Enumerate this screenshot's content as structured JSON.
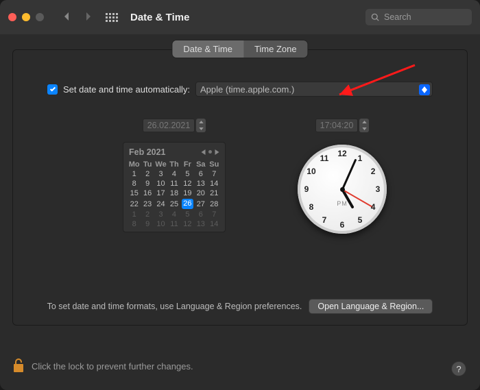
{
  "window": {
    "title": "Date & Time"
  },
  "search": {
    "placeholder": "Search"
  },
  "tabs": {
    "date_time": "Date & Time",
    "time_zone": "Time Zone"
  },
  "auto": {
    "label": "Set date and time automatically:",
    "server": "Apple (time.apple.com.)",
    "checked": true
  },
  "date_field": "26.02.2021",
  "time_field": "17:04:20",
  "calendar": {
    "title": "Feb 2021",
    "dow": [
      "Mo",
      "Tu",
      "We",
      "Th",
      "Fr",
      "Sa",
      "Su"
    ],
    "weeks": [
      [
        {
          "d": "1"
        },
        {
          "d": "2"
        },
        {
          "d": "3"
        },
        {
          "d": "4"
        },
        {
          "d": "5"
        },
        {
          "d": "6"
        },
        {
          "d": "7"
        }
      ],
      [
        {
          "d": "8"
        },
        {
          "d": "9"
        },
        {
          "d": "10"
        },
        {
          "d": "11"
        },
        {
          "d": "12"
        },
        {
          "d": "13"
        },
        {
          "d": "14"
        }
      ],
      [
        {
          "d": "15"
        },
        {
          "d": "16"
        },
        {
          "d": "17"
        },
        {
          "d": "18"
        },
        {
          "d": "19"
        },
        {
          "d": "20"
        },
        {
          "d": "21"
        }
      ],
      [
        {
          "d": "22"
        },
        {
          "d": "23"
        },
        {
          "d": "24"
        },
        {
          "d": "25"
        },
        {
          "d": "26",
          "sel": true
        },
        {
          "d": "27"
        },
        {
          "d": "28"
        }
      ],
      [
        {
          "d": "1",
          "dim": true
        },
        {
          "d": "2",
          "dim": true
        },
        {
          "d": "3",
          "dim": true
        },
        {
          "d": "4",
          "dim": true
        },
        {
          "d": "5",
          "dim": true
        },
        {
          "d": "6",
          "dim": true
        },
        {
          "d": "7",
          "dim": true
        }
      ],
      [
        {
          "d": "8",
          "dim": true
        },
        {
          "d": "9",
          "dim": true
        },
        {
          "d": "10",
          "dim": true
        },
        {
          "d": "11",
          "dim": true
        },
        {
          "d": "12",
          "dim": true
        },
        {
          "d": "13",
          "dim": true
        },
        {
          "d": "14",
          "dim": true
        }
      ]
    ]
  },
  "clock": {
    "numbers": [
      "12",
      "1",
      "2",
      "3",
      "4",
      "5",
      "6",
      "7",
      "8",
      "9",
      "10",
      "11"
    ],
    "ampm": "PM"
  },
  "format_hint": "To set date and time formats, use Language & Region preferences.",
  "open_lr_button": "Open Language & Region...",
  "lock_text": "Click the lock to prevent further changes.",
  "help": "?"
}
